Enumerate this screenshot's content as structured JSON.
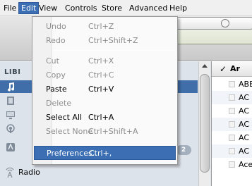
{
  "menubar": {
    "items": [
      {
        "label": "File"
      },
      {
        "label": "Edit"
      },
      {
        "label": "View"
      },
      {
        "label": "Controls"
      },
      {
        "label": "Store"
      },
      {
        "label": "Advanced"
      },
      {
        "label": "Help"
      }
    ],
    "active_item": "Edit"
  },
  "edit_menu": {
    "items": [
      {
        "label": "Undo",
        "shortcut": "Ctrl+Z",
        "enabled": false
      },
      {
        "label": "Redo",
        "shortcut": "Ctrl+Shift+Z",
        "enabled": false
      },
      {
        "label": "Cut",
        "shortcut": "Ctrl+X",
        "enabled": false
      },
      {
        "label": "Copy",
        "shortcut": "Ctrl+C",
        "enabled": false
      },
      {
        "label": "Paste",
        "shortcut": "Ctrl+V",
        "enabled": true
      },
      {
        "label": "Delete",
        "shortcut": "",
        "enabled": false
      },
      {
        "label": "Select All",
        "shortcut": "Ctrl+A",
        "enabled": true
      },
      {
        "label": "Select None",
        "shortcut": "Ctrl+Shift+A",
        "enabled": false
      },
      {
        "label": "Preferences...",
        "shortcut": "Ctrl+,",
        "enabled": true,
        "highlighted": true
      }
    ]
  },
  "sidebar": {
    "header": "LIBI",
    "badge": "2",
    "radio_label": "Radio",
    "icons": [
      "music-icon",
      "movies-icon",
      "tv-shows-icon",
      "podcasts-icon",
      "applications-icon",
      "radio-icon"
    ]
  },
  "songlist": {
    "header_check": "✓",
    "header_name": "Ar",
    "rows": [
      "ABE",
      "AC",
      "AC",
      "AC",
      "AC",
      "AC",
      "Ace"
    ]
  },
  "colors": {
    "menu_highlight": "#3c6eb4",
    "sidebar_bg": "#dde3ea",
    "sidebar_selected": "#3f6ea8"
  }
}
